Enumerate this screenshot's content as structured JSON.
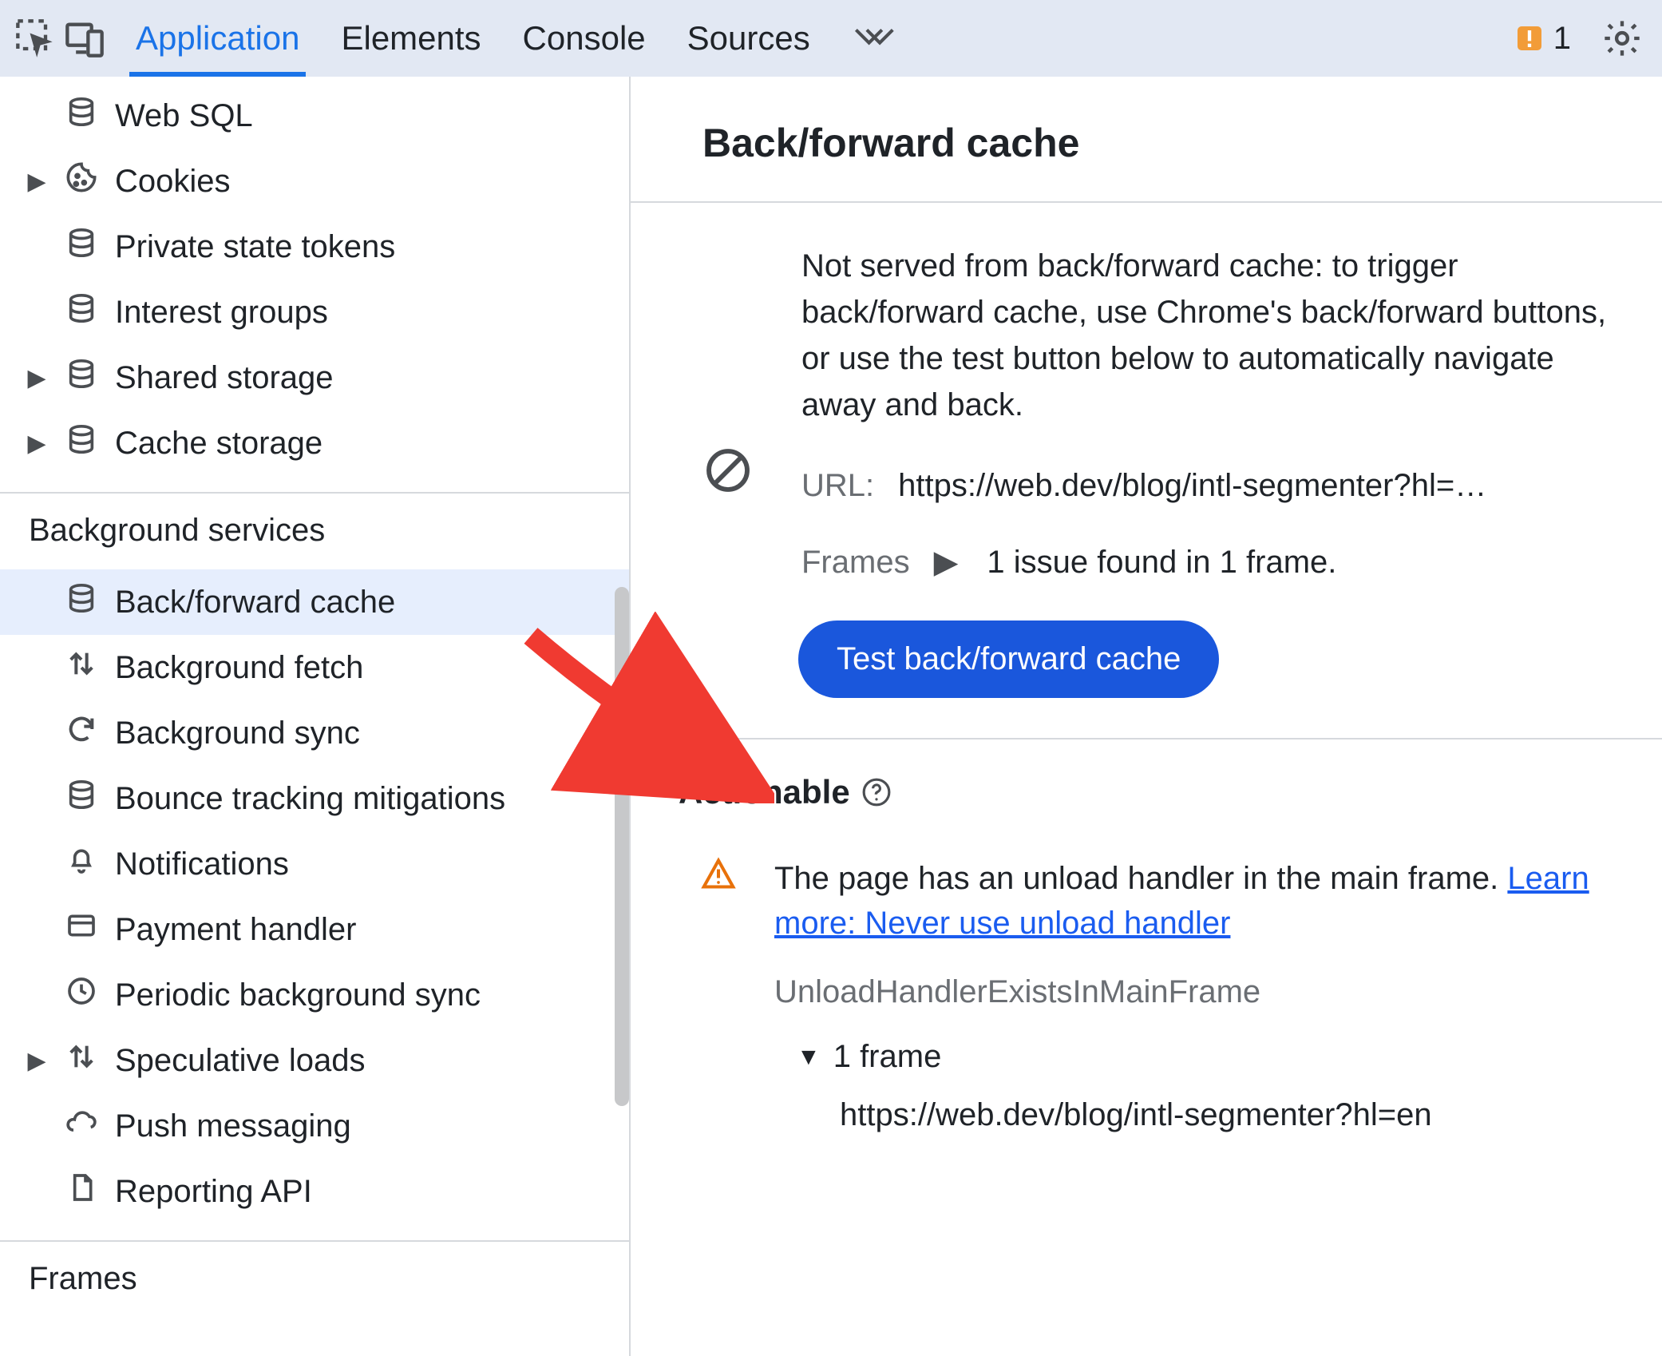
{
  "topbar": {
    "tabs": [
      "Application",
      "Elements",
      "Console",
      "Sources"
    ],
    "active_tab": 0,
    "issue_count": "1"
  },
  "sidebar": {
    "storage_items": [
      {
        "id": "web-sql",
        "label": "Web SQL",
        "icon": "db",
        "expandable": false,
        "selected": false
      },
      {
        "id": "cookies",
        "label": "Cookies",
        "icon": "cookie",
        "expandable": true,
        "selected": false
      },
      {
        "id": "private-state-tokens",
        "label": "Private state tokens",
        "icon": "db",
        "expandable": false,
        "selected": false
      },
      {
        "id": "interest-groups",
        "label": "Interest groups",
        "icon": "db",
        "expandable": false,
        "selected": false
      },
      {
        "id": "shared-storage",
        "label": "Shared storage",
        "icon": "db",
        "expandable": true,
        "selected": false
      },
      {
        "id": "cache-storage",
        "label": "Cache storage",
        "icon": "db",
        "expandable": true,
        "selected": false
      }
    ],
    "bg_title": "Background services",
    "bg_items": [
      {
        "id": "bfcache",
        "label": "Back/forward cache",
        "icon": "db",
        "expandable": false,
        "selected": true
      },
      {
        "id": "bgfetch",
        "label": "Background fetch",
        "icon": "updown",
        "expandable": false,
        "selected": false
      },
      {
        "id": "bgsync",
        "label": "Background sync",
        "icon": "sync",
        "expandable": false,
        "selected": false
      },
      {
        "id": "bounce",
        "label": "Bounce tracking mitigations",
        "icon": "db",
        "expandable": false,
        "selected": false
      },
      {
        "id": "notif",
        "label": "Notifications",
        "icon": "bell",
        "expandable": false,
        "selected": false
      },
      {
        "id": "payment",
        "label": "Payment handler",
        "icon": "card",
        "expandable": false,
        "selected": false
      },
      {
        "id": "periodic",
        "label": "Periodic background sync",
        "icon": "clock",
        "expandable": false,
        "selected": false
      },
      {
        "id": "specloads",
        "label": "Speculative loads",
        "icon": "updown",
        "expandable": true,
        "selected": false
      },
      {
        "id": "push",
        "label": "Push messaging",
        "icon": "cloud",
        "expandable": false,
        "selected": false
      },
      {
        "id": "reporting",
        "label": "Reporting API",
        "icon": "doc",
        "expandable": false,
        "selected": false
      }
    ],
    "frames_title": "Frames"
  },
  "content": {
    "title": "Back/forward cache",
    "info": "Not served from back/forward cache: to trigger back/forward cache, use Chrome's back/forward buttons, or use the test button below to automatically navigate away and back.",
    "url_label": "URL:",
    "url_value": "https://web.dev/blog/intl-segmenter?hl=…",
    "frames_label": "Frames",
    "frames_value": "1 issue found in 1 frame.",
    "test_button": "Test back/forward cache",
    "actionable_heading": "Actionable",
    "issue": {
      "message": "The page has an unload handler in the main frame. ",
      "link_text": "Learn more: Never use unload handler",
      "code": "UnloadHandlerExistsInMainFrame",
      "frame_count": "1 frame",
      "frame_url": "https://web.dev/blog/intl-segmenter?hl=en"
    }
  }
}
